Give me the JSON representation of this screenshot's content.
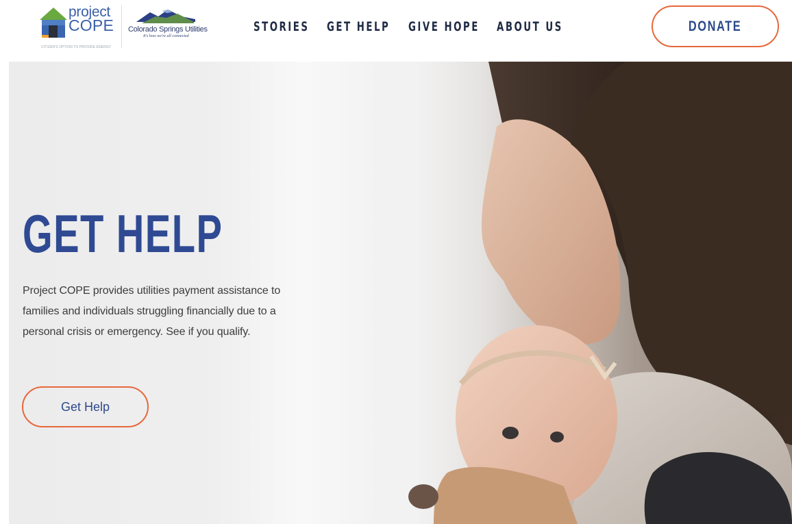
{
  "brand": {
    "project_cope_line1": "project",
    "project_cope_line2": "COPE",
    "project_cope_tagline": "CITIZEN'S OPTION TO PROVIDE ENERGY",
    "partner_name": "Colorado Springs Utilities",
    "partner_tagline": "It's how we're all connected"
  },
  "nav": {
    "items": [
      {
        "label": "STORIES"
      },
      {
        "label": "GET HELP"
      },
      {
        "label": "GIVE HOPE"
      },
      {
        "label": "ABOUT US"
      }
    ],
    "donate_label": "DONATE"
  },
  "hero": {
    "title": "GET HELP",
    "description": "Project COPE provides utilities payment assistance to families and individuals struggling financially due to a personal crisis or emergency. See if you qualify.",
    "button_label": "Get Help"
  },
  "colors": {
    "brand_blue": "#2f4a93",
    "accent_orange": "#e8673a",
    "nav_text": "#1f2a44"
  }
}
